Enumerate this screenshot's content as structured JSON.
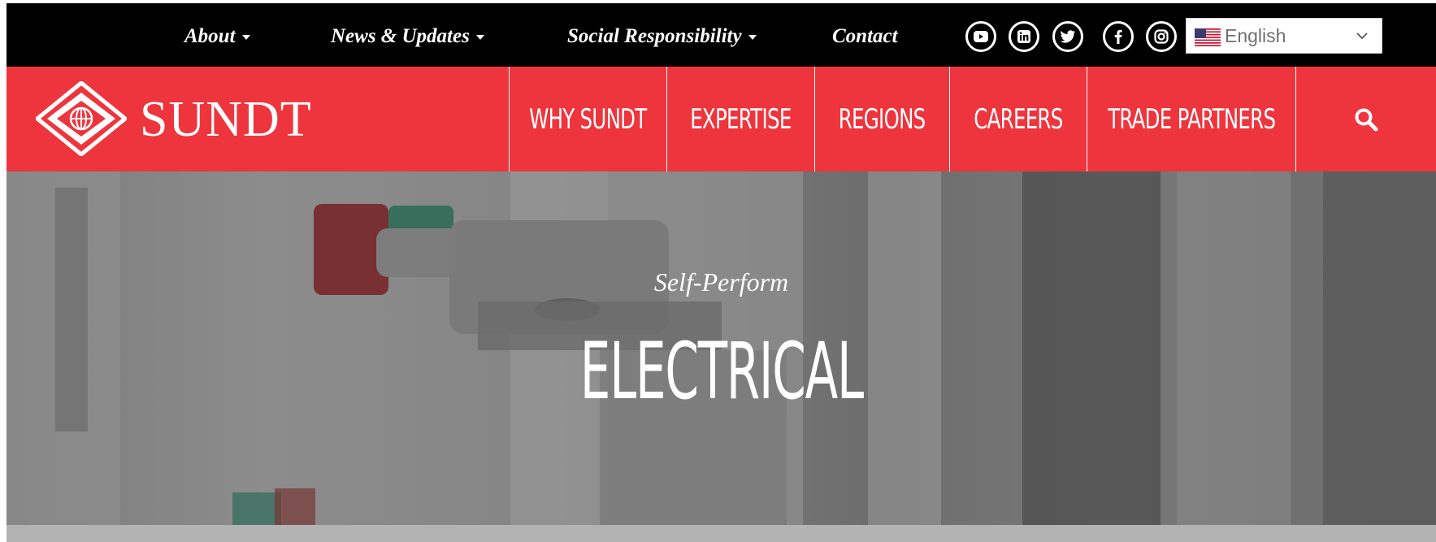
{
  "topbar": {
    "links": [
      {
        "label": "About",
        "has_dropdown": true
      },
      {
        "label": "News & Updates",
        "has_dropdown": true
      },
      {
        "label": "Social Responsibility",
        "has_dropdown": true
      },
      {
        "label": "Contact",
        "has_dropdown": false
      }
    ],
    "social_icons": [
      "youtube-icon",
      "linkedin-icon",
      "twitter-icon",
      "facebook-icon",
      "instagram-icon"
    ],
    "language": {
      "selected": "English",
      "flag": "us-flag-icon"
    }
  },
  "mainnav": {
    "logo_text": "SUNDT",
    "items": [
      "WHY SUNDT",
      "EXPERTISE",
      "REGIONS",
      "CAREERS",
      "TRADE PARTNERS"
    ],
    "search_icon": "search-icon"
  },
  "hero": {
    "subtitle": "Self-Perform",
    "title": "ELECTRICAL"
  },
  "colors": {
    "topbar_bg": "#000000",
    "brand_red": "#ee353d",
    "band_gray": "#b3b3b3"
  }
}
